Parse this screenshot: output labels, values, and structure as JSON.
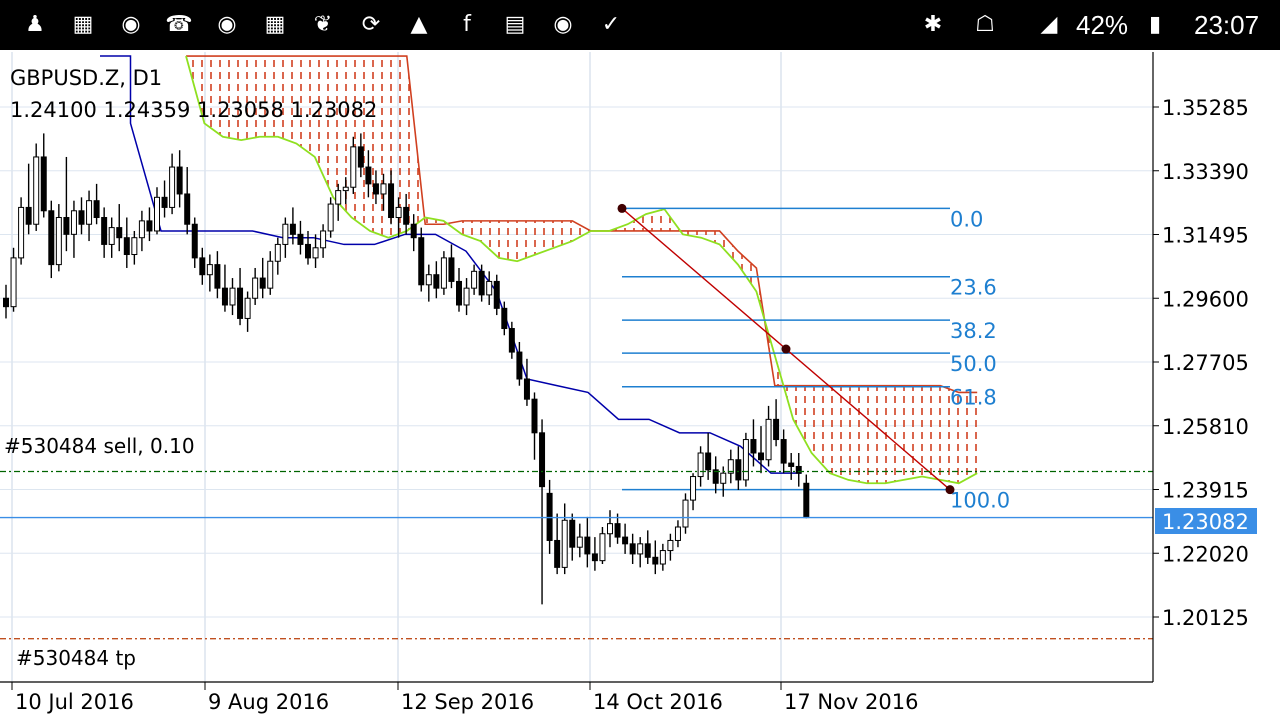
{
  "status_bar": {
    "icons": [
      "person-add-icon",
      "bbm-icon",
      "messenger-icon",
      "whatsapp-icon",
      "chat-icon",
      "bbm-icon",
      "script-icon",
      "screen-rotate-icon",
      "gallery-icon",
      "facebook-icon",
      "clipboard-icon",
      "messenger-icon",
      "clipboard-check-icon"
    ],
    "right_icons": [
      "bluetooth-icon",
      "wifi-icon",
      "signal-icon",
      "battery-icon"
    ],
    "battery": "42%",
    "time": "23:07"
  },
  "chart_header": {
    "symbol": "GBPUSD.Z, D1",
    "ohlc": "1.24100 1.24359 1.23058 1.23082"
  },
  "orders": {
    "sell_label": "#530484 sell, 0.10",
    "sell_price": 1.2445,
    "tp_label": "#530484 tp",
    "tp_price": 1.1948
  },
  "current_price": {
    "label": "1.23082",
    "value": 1.23082
  },
  "colors": {
    "candle": "#000000",
    "kijun": "#0000aa",
    "senkou_a": "#8fe020",
    "cloud_red": "#d04020",
    "fib": "#1e7fd0",
    "trendline": "#c00000",
    "price_line": "#3a8ee6",
    "price_tag_bg": "#3a8ee6",
    "grid": "#c8d4e4",
    "sell_line": "#006400",
    "tp_line": "#c05020"
  },
  "chart_data": {
    "type": "candlestick",
    "symbol": "GBPUSD.Z",
    "timeframe": "D1",
    "y_ticks": [
      "1.35285",
      "1.33390",
      "1.31495",
      "1.29600",
      "1.27705",
      "1.25810",
      "1.23915",
      "1.22020",
      "1.20125"
    ],
    "x_ticks": [
      "10 Jul 2016",
      "9 Aug 2016",
      "12 Sep 2016",
      "14 Oct 2016",
      "17 Nov 2016"
    ],
    "ylim": [
      1.1915,
      1.368
    ],
    "fibonacci": {
      "levels": [
        "0.0",
        "23.6",
        "38.2",
        "50.0",
        "61.8",
        "100.0"
      ],
      "prices": [
        1.3227,
        1.3024,
        1.2895,
        1.2797,
        1.2697,
        1.2391
      ],
      "trend_from": 1.3227,
      "trend_to": 1.2391
    },
    "candles": [
      [
        1.296,
        1.3,
        1.29,
        1.2935
      ],
      [
        1.2935,
        1.311,
        1.292,
        1.308
      ],
      [
        1.308,
        1.326,
        1.306,
        1.323
      ],
      [
        1.323,
        1.336,
        1.315,
        1.318
      ],
      [
        1.318,
        1.342,
        1.316,
        1.338
      ],
      [
        1.338,
        1.345,
        1.32,
        1.322
      ],
      [
        1.322,
        1.325,
        1.302,
        1.306
      ],
      [
        1.306,
        1.324,
        1.304,
        1.32
      ],
      [
        1.32,
        1.338,
        1.31,
        1.315
      ],
      [
        1.315,
        1.325,
        1.308,
        1.322
      ],
      [
        1.322,
        1.326,
        1.315,
        1.318
      ],
      [
        1.318,
        1.328,
        1.313,
        1.325
      ],
      [
        1.325,
        1.33,
        1.318,
        1.32
      ],
      [
        1.32,
        1.323,
        1.308,
        1.312
      ],
      [
        1.312,
        1.32,
        1.308,
        1.317
      ],
      [
        1.317,
        1.324,
        1.31,
        1.314
      ],
      [
        1.314,
        1.32,
        1.305,
        1.309
      ],
      [
        1.309,
        1.316,
        1.306,
        1.314
      ],
      [
        1.314,
        1.322,
        1.31,
        1.319
      ],
      [
        1.319,
        1.323,
        1.313,
        1.316
      ],
      [
        1.316,
        1.329,
        1.315,
        1.326
      ],
      [
        1.326,
        1.331,
        1.32,
        1.323
      ],
      [
        1.323,
        1.339,
        1.321,
        1.335
      ],
      [
        1.335,
        1.34,
        1.323,
        1.327
      ],
      [
        1.327,
        1.335,
        1.315,
        1.318
      ],
      [
        1.318,
        1.32,
        1.305,
        1.308
      ],
      [
        1.308,
        1.311,
        1.3,
        1.303
      ],
      [
        1.303,
        1.309,
        1.298,
        1.306
      ],
      [
        1.306,
        1.31,
        1.296,
        1.299
      ],
      [
        1.299,
        1.306,
        1.292,
        1.294
      ],
      [
        1.294,
        1.302,
        1.291,
        1.299
      ],
      [
        1.299,
        1.305,
        1.288,
        1.29
      ],
      [
        1.29,
        1.298,
        1.286,
        1.296
      ],
      [
        1.296,
        1.305,
        1.294,
        1.302
      ],
      [
        1.302,
        1.308,
        1.296,
        1.299
      ],
      [
        1.299,
        1.31,
        1.297,
        1.307
      ],
      [
        1.307,
        1.314,
        1.303,
        1.312
      ],
      [
        1.312,
        1.32,
        1.308,
        1.318
      ],
      [
        1.318,
        1.323,
        1.312,
        1.315
      ],
      [
        1.315,
        1.319,
        1.309,
        1.312
      ],
      [
        1.312,
        1.316,
        1.306,
        1.308
      ],
      [
        1.308,
        1.315,
        1.305,
        1.311
      ],
      [
        1.311,
        1.318,
        1.308,
        1.316
      ],
      [
        1.316,
        1.326,
        1.314,
        1.324
      ],
      [
        1.324,
        1.33,
        1.319,
        1.328
      ],
      [
        1.328,
        1.332,
        1.324,
        1.329
      ],
      [
        1.329,
        1.344,
        1.327,
        1.341
      ],
      [
        1.341,
        1.345,
        1.332,
        1.335
      ],
      [
        1.335,
        1.34,
        1.326,
        1.33
      ],
      [
        1.33,
        1.334,
        1.324,
        1.327
      ],
      [
        1.327,
        1.333,
        1.322,
        1.33
      ],
      [
        1.33,
        1.334,
        1.318,
        1.32
      ],
      [
        1.32,
        1.326,
        1.314,
        1.323
      ],
      [
        1.323,
        1.327,
        1.315,
        1.318
      ],
      [
        1.318,
        1.321,
        1.31,
        1.314
      ],
      [
        1.314,
        1.317,
        1.298,
        1.3
      ],
      [
        1.3,
        1.306,
        1.295,
        1.303
      ],
      [
        1.303,
        1.307,
        1.296,
        1.299
      ],
      [
        1.299,
        1.31,
        1.297,
        1.308
      ],
      [
        1.308,
        1.312,
        1.299,
        1.301
      ],
      [
        1.301,
        1.305,
        1.292,
        1.294
      ],
      [
        1.294,
        1.302,
        1.291,
        1.299
      ],
      [
        1.299,
        1.306,
        1.297,
        1.304
      ],
      [
        1.304,
        1.306,
        1.295,
        1.297
      ],
      [
        1.297,
        1.304,
        1.294,
        1.301
      ],
      [
        1.301,
        1.303,
        1.291,
        1.293
      ],
      [
        1.293,
        1.295,
        1.285,
        1.287
      ],
      [
        1.287,
        1.289,
        1.278,
        1.28
      ],
      [
        1.28,
        1.283,
        1.27,
        1.272
      ],
      [
        1.272,
        1.278,
        1.264,
        1.266
      ],
      [
        1.266,
        1.268,
        1.248,
        1.256
      ],
      [
        1.256,
        1.26,
        1.205,
        1.24
      ],
      [
        1.238,
        1.242,
        1.22,
        1.224
      ],
      [
        1.224,
        1.232,
        1.214,
        1.216
      ],
      [
        1.216,
        1.235,
        1.214,
        1.23
      ],
      [
        1.23,
        1.232,
        1.218,
        1.222
      ],
      [
        1.222,
        1.229,
        1.219,
        1.225
      ],
      [
        1.225,
        1.231,
        1.216,
        1.22
      ],
      [
        1.22,
        1.225,
        1.215,
        1.218
      ],
      [
        1.218,
        1.228,
        1.217,
        1.226
      ],
      [
        1.226,
        1.233,
        1.222,
        1.229
      ],
      [
        1.229,
        1.232,
        1.223,
        1.225
      ],
      [
        1.225,
        1.229,
        1.22,
        1.223
      ],
      [
        1.223,
        1.226,
        1.217,
        1.22
      ],
      [
        1.22,
        1.225,
        1.216,
        1.223
      ],
      [
        1.223,
        1.227,
        1.217,
        1.219
      ],
      [
        1.219,
        1.224,
        1.214,
        1.217
      ],
      [
        1.217,
        1.223,
        1.215,
        1.221
      ],
      [
        1.221,
        1.226,
        1.218,
        1.224
      ],
      [
        1.224,
        1.23,
        1.222,
        1.228
      ],
      [
        1.228,
        1.238,
        1.226,
        1.236
      ],
      [
        1.236,
        1.244,
        1.233,
        1.243
      ],
      [
        1.243,
        1.252,
        1.24,
        1.25
      ],
      [
        1.25,
        1.256,
        1.242,
        1.245
      ],
      [
        1.245,
        1.249,
        1.238,
        1.241
      ],
      [
        1.241,
        1.246,
        1.237,
        1.244
      ],
      [
        1.244,
        1.251,
        1.241,
        1.248
      ],
      [
        1.248,
        1.252,
        1.239,
        1.242
      ],
      [
        1.242,
        1.256,
        1.24,
        1.254
      ],
      [
        1.254,
        1.26,
        1.246,
        1.25
      ],
      [
        1.25,
        1.258,
        1.244,
        1.248
      ],
      [
        1.248,
        1.264,
        1.246,
        1.26
      ],
      [
        1.26,
        1.266,
        1.252,
        1.254
      ],
      [
        1.254,
        1.257,
        1.244,
        1.247
      ],
      [
        1.247,
        1.25,
        1.242,
        1.246
      ],
      [
        1.246,
        1.25,
        1.24,
        1.244
      ],
      [
        1.241,
        1.2436,
        1.2306,
        1.2308
      ]
    ],
    "kijun_sen": [
      [
        1.368,
        1.368
      ],
      [
        1.348,
        1.316
      ],
      [
        1.316,
        1.316
      ],
      [
        1.316,
        1.316
      ],
      [
        1.316,
        1.316
      ],
      [
        1.316,
        1.314
      ],
      [
        1.314,
        1.314
      ],
      [
        1.314,
        1.312
      ],
      [
        1.312,
        1.312
      ],
      [
        1.312,
        1.315
      ],
      [
        1.315,
        1.315
      ],
      [
        1.315,
        1.31
      ],
      [
        1.31,
        1.298
      ],
      [
        1.298,
        1.272
      ],
      [
        1.272,
        1.27
      ],
      [
        1.27,
        1.268
      ],
      [
        1.268,
        1.26
      ],
      [
        1.26,
        1.26
      ],
      [
        1.26,
        1.256
      ],
      [
        1.256,
        1.256
      ],
      [
        1.256,
        1.252
      ],
      [
        1.252,
        1.244
      ],
      [
        1.244,
        1.244
      ]
    ],
    "senkou_a": [
      1.368,
      1.348,
      1.344,
      1.343,
      1.344,
      1.344,
      1.342,
      1.338,
      1.326,
      1.32,
      1.316,
      1.314,
      1.316,
      1.32,
      1.319,
      1.315,
      1.313,
      1.308,
      1.307,
      1.309,
      1.311,
      1.313,
      1.316,
      1.316,
      1.318,
      1.321,
      1.3225,
      1.315,
      1.314,
      1.312,
      1.306,
      1.298,
      1.279,
      1.26,
      1.25,
      1.244,
      1.242,
      1.241,
      1.241,
      1.242,
      1.243,
      1.242,
      1.241,
      1.244
    ],
    "senkou_b": [
      1.368,
      1.368,
      1.368,
      1.368,
      1.368,
      1.368,
      1.368,
      1.368,
      1.368,
      1.368,
      1.368,
      1.368,
      1.368,
      1.318,
      1.318,
      1.319,
      1.319,
      1.319,
      1.319,
      1.319,
      1.319,
      1.319,
      1.316,
      1.316,
      1.316,
      1.316,
      1.316,
      1.316,
      1.316,
      1.316,
      1.31,
      1.305,
      1.27,
      1.27,
      1.27,
      1.27,
      1.27,
      1.27,
      1.27,
      1.27,
      1.27,
      1.27,
      1.268,
      1.268
    ]
  }
}
